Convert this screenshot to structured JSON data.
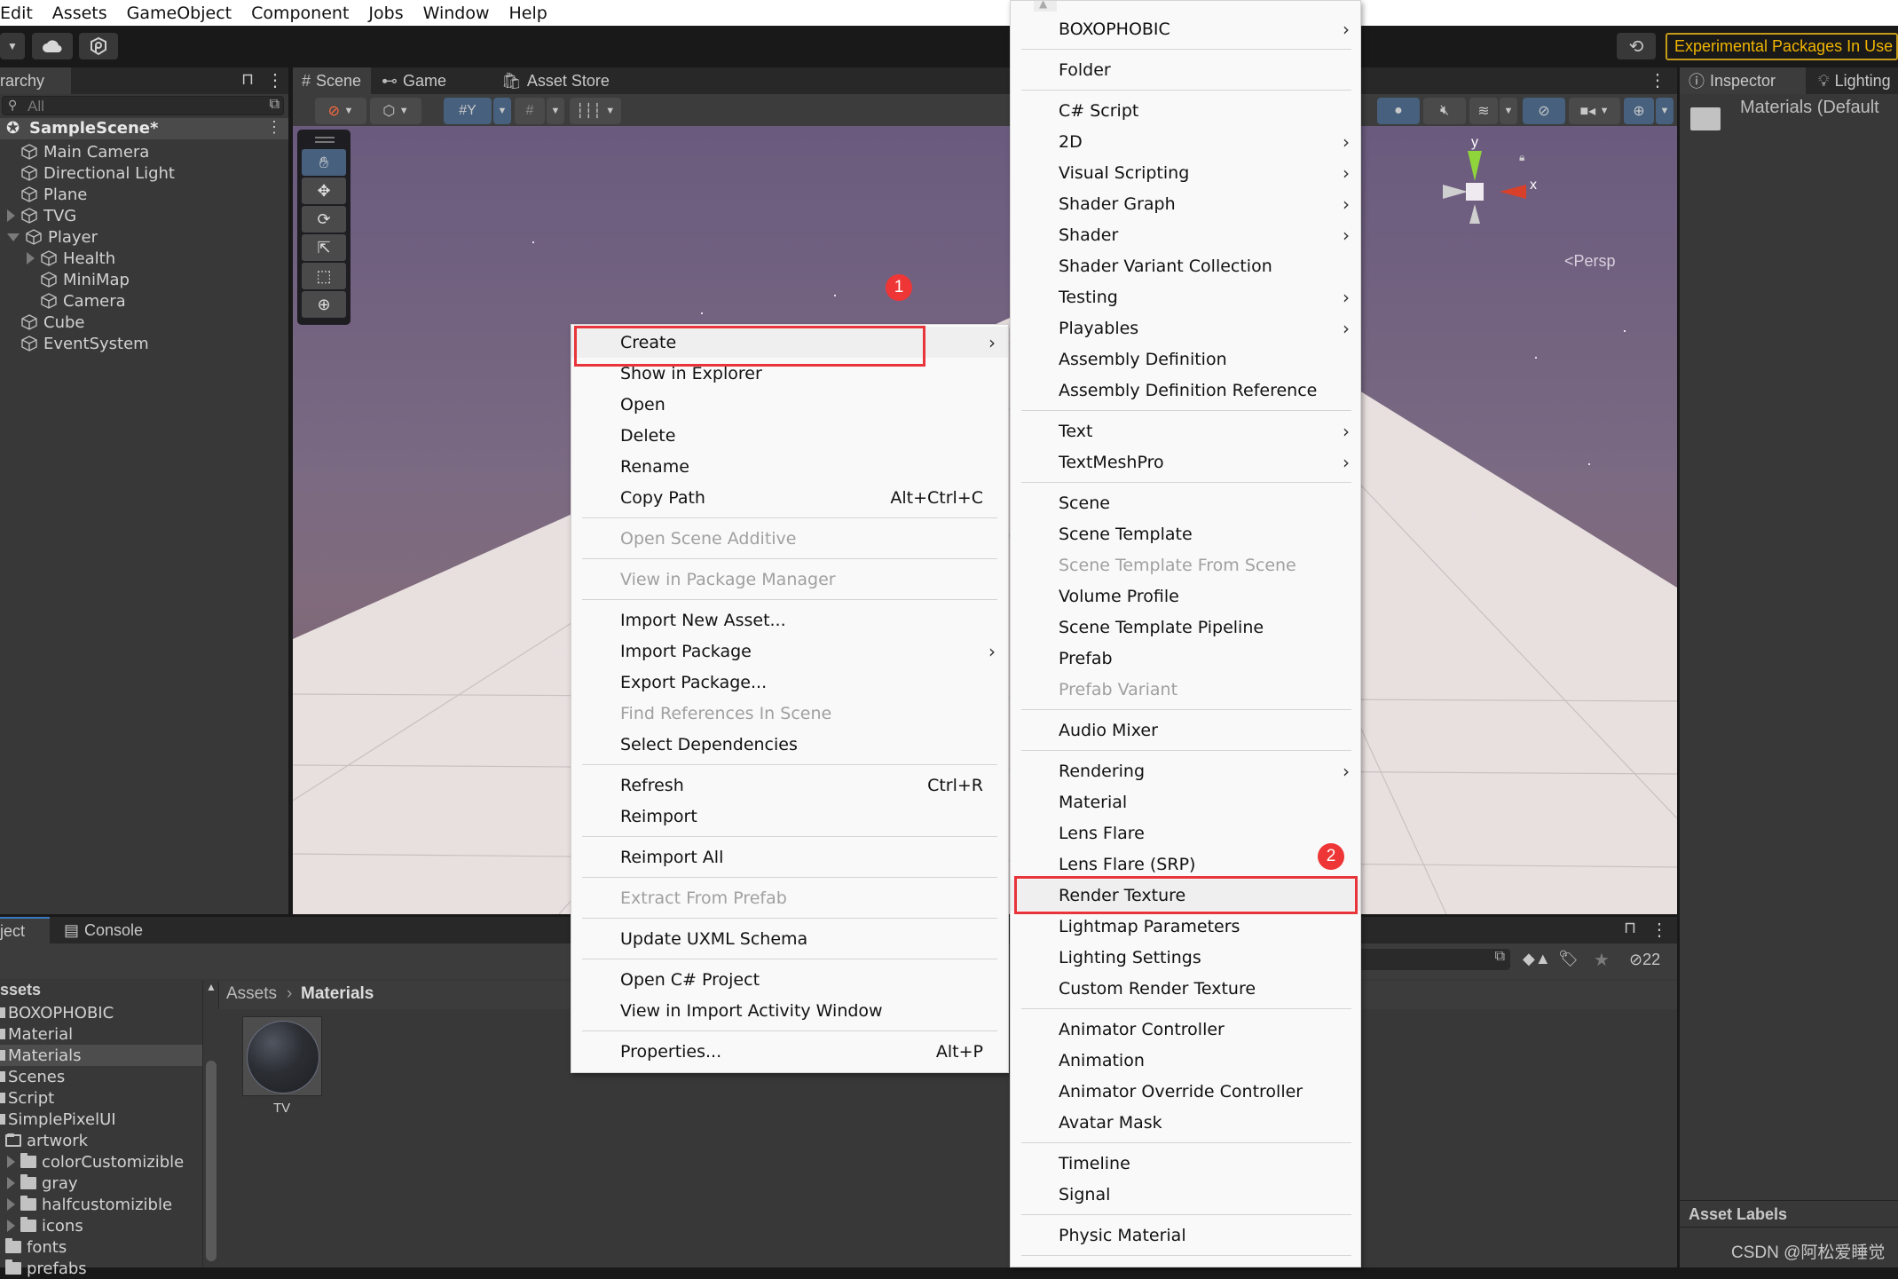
{
  "menubar": {
    "items": [
      "Edit",
      "Assets",
      "GameObject",
      "Component",
      "Jobs",
      "Window",
      "Help"
    ]
  },
  "toolbar": {
    "account_glyph": "☰",
    "experimental_label": "Experimental Packages In Use"
  },
  "hierarchy": {
    "tab_label": "rarchy",
    "search_placeholder": "All",
    "scene_name": "SampleScene*",
    "items": [
      {
        "label": "Main Camera",
        "depth": 1,
        "expander": "none"
      },
      {
        "label": "Directional Light",
        "depth": 1,
        "expander": "none"
      },
      {
        "label": "Plane",
        "depth": 1,
        "expander": "none"
      },
      {
        "label": "TVG",
        "depth": 1,
        "expander": "collapsed"
      },
      {
        "label": "Player",
        "depth": 1,
        "expander": "expanded"
      },
      {
        "label": "Health",
        "depth": 2,
        "expander": "collapsed"
      },
      {
        "label": "MiniMap",
        "depth": 2,
        "expander": "none"
      },
      {
        "label": "Camera",
        "depth": 2,
        "expander": "none"
      },
      {
        "label": "Cube",
        "depth": 1,
        "expander": "none"
      },
      {
        "label": "EventSystem",
        "depth": 1,
        "expander": "none"
      }
    ]
  },
  "scene_view": {
    "tabs": [
      {
        "label": "Scene",
        "icon": "grid-hash-icon",
        "active": true
      },
      {
        "label": "Game",
        "icon": "gamepad-icon",
        "active": false
      },
      {
        "label": "Asset Store",
        "icon": "shopping-bag-icon",
        "active": false
      }
    ],
    "tools": [
      "hand-tool",
      "move-tool",
      "rotate-tool",
      "scale-tool",
      "rect-tool",
      "transform-tool"
    ],
    "gizmo": {
      "y_label": "y",
      "x_label": "x",
      "projection": "Persp"
    }
  },
  "inspector": {
    "tabs": [
      {
        "label": "Inspector",
        "icon": "info-icon"
      },
      {
        "label": "Lighting",
        "icon": "bulb-icon"
      }
    ],
    "title": "Materials (Default",
    "asset_labels": "Asset Labels"
  },
  "project": {
    "tabs": [
      {
        "label": "ject"
      },
      {
        "label": "Console"
      }
    ],
    "tree_root": "ssets",
    "tree": [
      {
        "label": "BOXOPHOBIC",
        "depth": 0,
        "selected": false
      },
      {
        "label": "Material",
        "depth": 0,
        "selected": false
      },
      {
        "label": "Materials",
        "depth": 0,
        "selected": true
      },
      {
        "label": "Scenes",
        "depth": 0,
        "selected": false
      },
      {
        "label": "Script",
        "depth": 0,
        "selected": false
      },
      {
        "label": "SimplePixelUI",
        "depth": 0,
        "selected": false
      },
      {
        "label": "artwork",
        "depth": 1,
        "selected": false,
        "open": true
      },
      {
        "label": "colorCustomizible",
        "depth": 2,
        "selected": false
      },
      {
        "label": "gray",
        "depth": 2,
        "selected": false
      },
      {
        "label": "halfcustomizible",
        "depth": 2,
        "selected": false
      },
      {
        "label": "icons",
        "depth": 2,
        "selected": false
      },
      {
        "label": "fonts",
        "depth": 1,
        "selected": false
      },
      {
        "label": "prefabs",
        "depth": 1,
        "selected": false
      }
    ],
    "breadcrumb": [
      "Assets",
      "Materials"
    ],
    "assets": [
      {
        "name": "TV",
        "type": "material"
      }
    ],
    "hidden_count": "22"
  },
  "context_menu": {
    "items": [
      {
        "label": "Create",
        "submenu": true,
        "highlighted": true
      },
      {
        "label": "Show in Explorer"
      },
      {
        "label": "Open"
      },
      {
        "label": "Delete"
      },
      {
        "label": "Rename"
      },
      {
        "label": "Copy Path",
        "shortcut": "Alt+Ctrl+C"
      },
      {
        "sep": true
      },
      {
        "label": "Open Scene Additive",
        "disabled": true
      },
      {
        "sep": true
      },
      {
        "label": "View in Package Manager",
        "disabled": true
      },
      {
        "sep": true
      },
      {
        "label": "Import New Asset..."
      },
      {
        "label": "Import Package",
        "submenu": true
      },
      {
        "label": "Export Package..."
      },
      {
        "label": "Find References In Scene",
        "disabled": true
      },
      {
        "label": "Select Dependencies"
      },
      {
        "sep": true
      },
      {
        "label": "Refresh",
        "shortcut": "Ctrl+R"
      },
      {
        "label": "Reimport"
      },
      {
        "sep": true
      },
      {
        "label": "Reimport All"
      },
      {
        "sep": true
      },
      {
        "label": "Extract From Prefab",
        "disabled": true
      },
      {
        "sep": true
      },
      {
        "label": "Update UXML Schema"
      },
      {
        "sep": true
      },
      {
        "label": "Open C# Project"
      },
      {
        "label": "View in Import Activity Window"
      },
      {
        "sep": true
      },
      {
        "label": "Properties...",
        "shortcut": "Alt+P"
      }
    ]
  },
  "create_submenu": {
    "items": [
      {
        "label": "BOXOPHOBIC",
        "submenu": true
      },
      {
        "sep": true
      },
      {
        "label": "Folder"
      },
      {
        "sep": true
      },
      {
        "label": "C# Script"
      },
      {
        "label": "2D",
        "submenu": true
      },
      {
        "label": "Visual Scripting",
        "submenu": true
      },
      {
        "label": "Shader Graph",
        "submenu": true
      },
      {
        "label": "Shader",
        "submenu": true
      },
      {
        "label": "Shader Variant Collection"
      },
      {
        "label": "Testing",
        "submenu": true
      },
      {
        "label": "Playables",
        "submenu": true
      },
      {
        "label": "Assembly Definition"
      },
      {
        "label": "Assembly Definition Reference"
      },
      {
        "sep": true
      },
      {
        "label": "Text",
        "submenu": true
      },
      {
        "label": "TextMeshPro",
        "submenu": true
      },
      {
        "sep": true
      },
      {
        "label": "Scene"
      },
      {
        "label": "Scene Template"
      },
      {
        "label": "Scene Template From Scene",
        "disabled": true
      },
      {
        "label": "Volume Profile"
      },
      {
        "label": "Scene Template Pipeline"
      },
      {
        "label": "Prefab"
      },
      {
        "label": "Prefab Variant",
        "disabled": true
      },
      {
        "sep": true
      },
      {
        "label": "Audio Mixer"
      },
      {
        "sep": true
      },
      {
        "label": "Rendering",
        "submenu": true
      },
      {
        "label": "Material"
      },
      {
        "label": "Lens Flare"
      },
      {
        "label": "Lens Flare (SRP)"
      },
      {
        "label": "Render Texture",
        "highlighted": true
      },
      {
        "label": "Lightmap Parameters"
      },
      {
        "label": "Lighting Settings"
      },
      {
        "label": "Custom Render Texture"
      },
      {
        "sep": true
      },
      {
        "label": "Animator Controller"
      },
      {
        "label": "Animation"
      },
      {
        "label": "Animator Override Controller"
      },
      {
        "label": "Avatar Mask"
      },
      {
        "sep": true
      },
      {
        "label": "Timeline"
      },
      {
        "label": "Signal"
      },
      {
        "sep": true
      },
      {
        "label": "Physic Material"
      },
      {
        "sep": true
      }
    ]
  },
  "annotations": {
    "step1": "1",
    "step2": "2",
    "accent": "#e8353b"
  },
  "watermark": "CSDN @阿松爱睡觉",
  "glyphs": {
    "submenu_arrow": "›",
    "breadcrumb_sep": "›",
    "kebab": "⋮"
  }
}
